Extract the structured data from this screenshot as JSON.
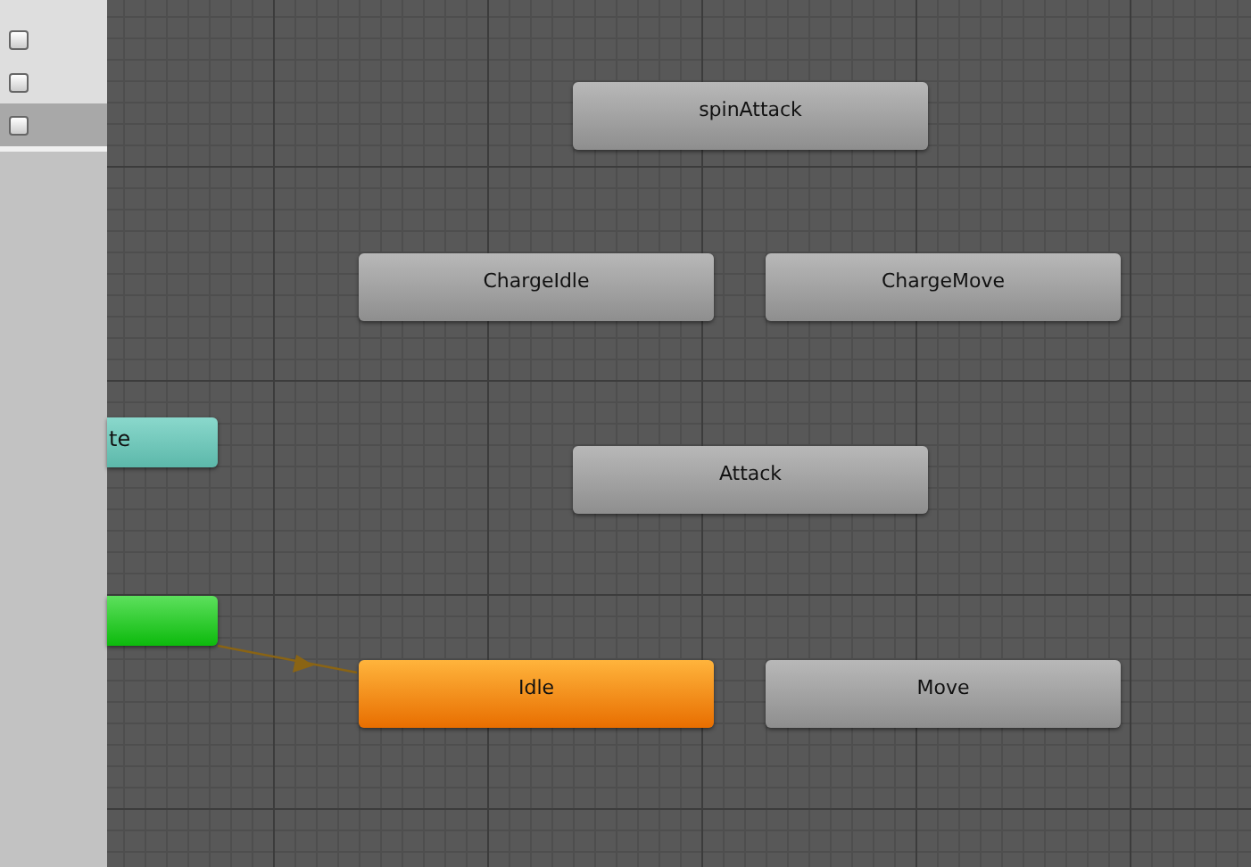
{
  "sidebar": {
    "rows": [
      {
        "checked": false,
        "selected": false
      },
      {
        "checked": false,
        "selected": false
      },
      {
        "checked": false,
        "selected": true
      }
    ]
  },
  "states": [
    {
      "label": "spinAttack",
      "kind": "state"
    },
    {
      "label": "ChargeIdle",
      "kind": "state"
    },
    {
      "label": "ChargeMove",
      "kind": "state"
    },
    {
      "label": "te",
      "kind": "any"
    },
    {
      "label": "Attack",
      "kind": "state"
    },
    {
      "kind": "entry"
    },
    {
      "label": "Idle",
      "kind": "default"
    },
    {
      "label": "Move",
      "kind": "state"
    }
  ]
}
